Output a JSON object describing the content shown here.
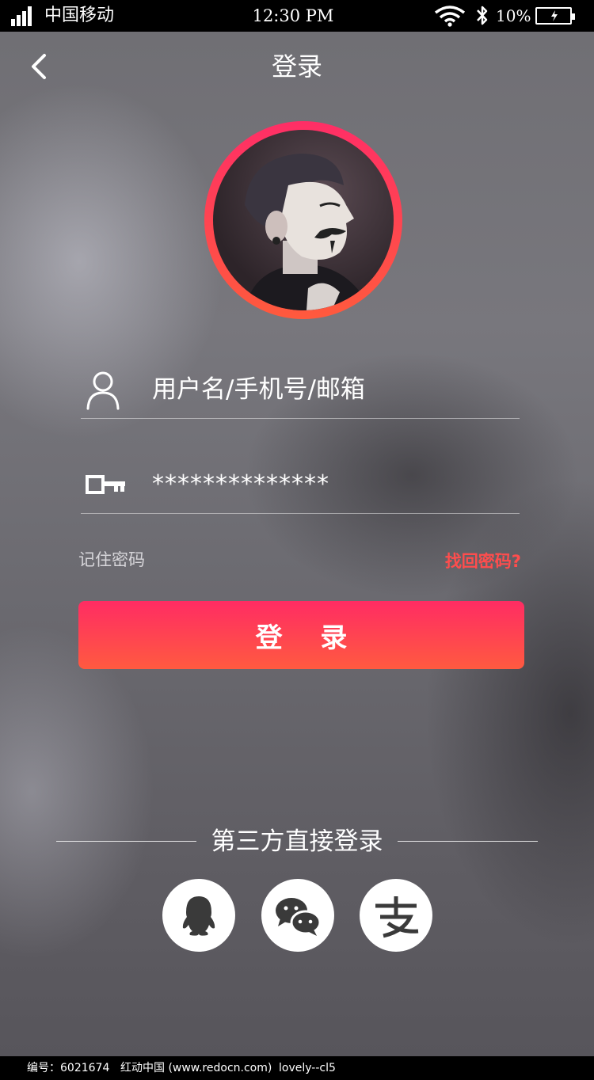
{
  "status_bar": {
    "carrier": "中国移动",
    "time": "12:30 PM",
    "battery_percent": "10%"
  },
  "nav": {
    "title": "登录",
    "back_icon": "chevron-left-icon"
  },
  "avatar": {
    "ring_colors": [
      "#ff2e66",
      "#ff5a3d"
    ]
  },
  "form": {
    "username_placeholder": "用户名/手机号/邮箱",
    "password_value": "**************",
    "user_icon": "user-icon",
    "key_icon": "key-icon",
    "remember_label": "记住密码",
    "forgot_label": "找回密码?",
    "login_button": "登 录"
  },
  "third_party": {
    "title": "第三方直接登录",
    "providers": [
      {
        "icon": "qq-icon"
      },
      {
        "icon": "wechat-icon"
      },
      {
        "icon": "alipay-icon"
      }
    ]
  },
  "footer": {
    "id_text": "编号：6021674",
    "site_text": "红动中国 (www.redocn.com)",
    "author_text": "lovely--cl5"
  },
  "colors": {
    "accent_start": "#ff2c63",
    "accent_end": "#ff5a40",
    "forgot_text": "#ff4d4d"
  }
}
